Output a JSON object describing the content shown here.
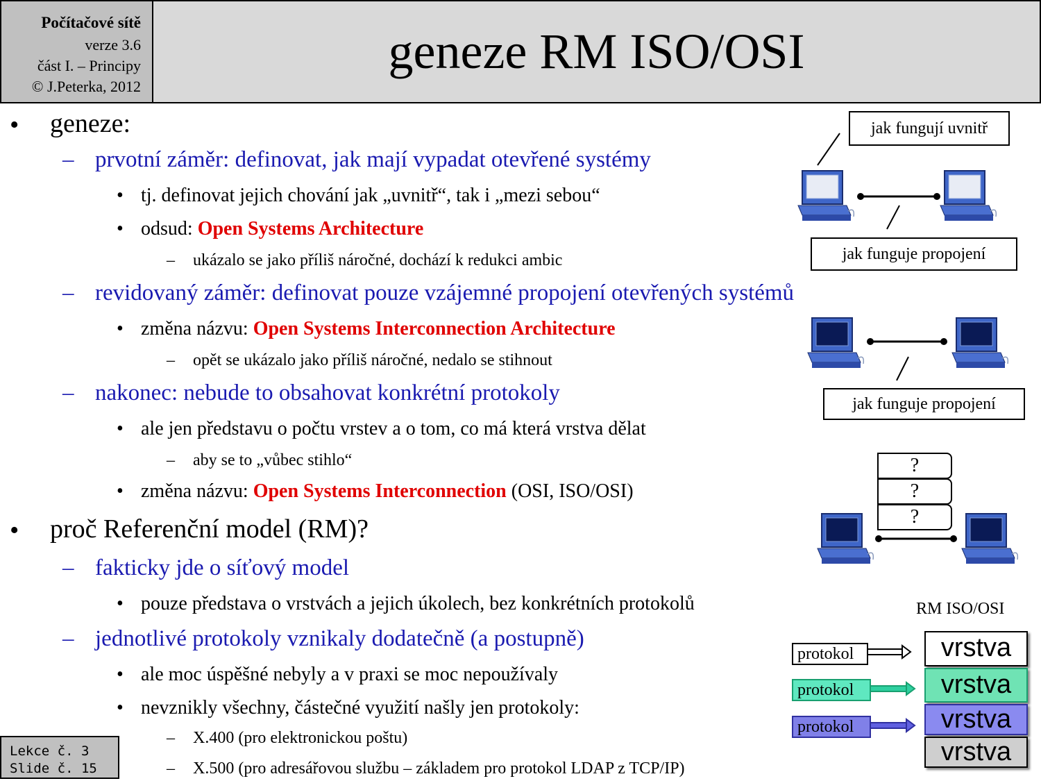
{
  "header": {
    "course": "Počítačové sítě",
    "version": "verze 3.6",
    "part": "část I.  – Principy",
    "copyright": "© J.Peterka, 2012",
    "title": "geneze RM ISO/OSI"
  },
  "content": {
    "b1": "geneze:",
    "b1_1": "prvotní záměr: definovat, jak mají vypadat otevřené systémy",
    "b1_1_1": "tj. definovat jejich chování jak „uvnitř“, tak i „mezi sebou“",
    "b1_1_2_pre": "odsud: ",
    "b1_1_2_red": "Open Systems Architecture",
    "b1_1_2_1": "ukázalo se jako příliš náročné, dochází k redukci ambic",
    "b1_2": "revidovaný záměr: definovat pouze vzájemné propojení otevřených systémů",
    "b1_2_1_pre": "změna názvu: ",
    "b1_2_1_red": "Open Systems Interconnection Architecture",
    "b1_2_1_1": "opět se ukázalo jako příliš náročné, nedalo se stihnout",
    "b1_3": "nakonec: nebude to obsahovat konkrétní protokoly",
    "b1_3_1": "ale jen představu o počtu vrstev a o tom, co má která vrstva dělat",
    "b1_3_1_1": "aby se to „vůbec stihlo“",
    "b1_3_2_pre": "změna názvu: ",
    "b1_3_2_red": "Open Systems Interconnection",
    "b1_3_2_post": " (OSI, ISO/OSI)",
    "b2": "proč Referenční model (RM)?",
    "b2_1": "fakticky jde o síťový model",
    "b2_1_1": "pouze představa o vrstvách a jejich úkolech, bez konkrétních protokolů",
    "b2_2": "jednotlivé protokoly vznikaly dodatečně (a postupně)",
    "b2_2_1": "ale moc úspěšné nebyly a v praxi se moc nepoužívaly",
    "b2_2_2": "nevznikly všechny, částečné využití našly jen protokoly:",
    "b2_2_2_1": "X.400 (pro elektronickou poštu)",
    "b2_2_2_2": "X.500 (pro adresářovou službu – základem pro protokol LDAP z TCP/IP)"
  },
  "markers": {
    "bullet": "•",
    "dash": "–"
  },
  "diagrams": {
    "inside_label": "jak fungují uvnitř",
    "link_label_1": "jak funguje propojení",
    "link_label_2": "jak funguje propojení",
    "unknown_layers": [
      "?",
      "?",
      "?"
    ],
    "model_title": "RM ISO/OSI",
    "layers": [
      {
        "label": "vrstva",
        "color": "#ffffff"
      },
      {
        "label": "vrstva",
        "color": "#6fe3b4"
      },
      {
        "label": "vrstva",
        "color": "#8a8af0"
      },
      {
        "label": "vrstva",
        "color": "#cfcfcf"
      }
    ],
    "protocols": [
      {
        "label": "protokol",
        "color": "#ffffff"
      },
      {
        "label": "protokol",
        "color": "#2fd0a0"
      },
      {
        "label": "protokol",
        "color": "#6060e0"
      }
    ]
  },
  "footer": {
    "lecture": "Lekce č. 3",
    "slide": "Slide č. 15"
  }
}
